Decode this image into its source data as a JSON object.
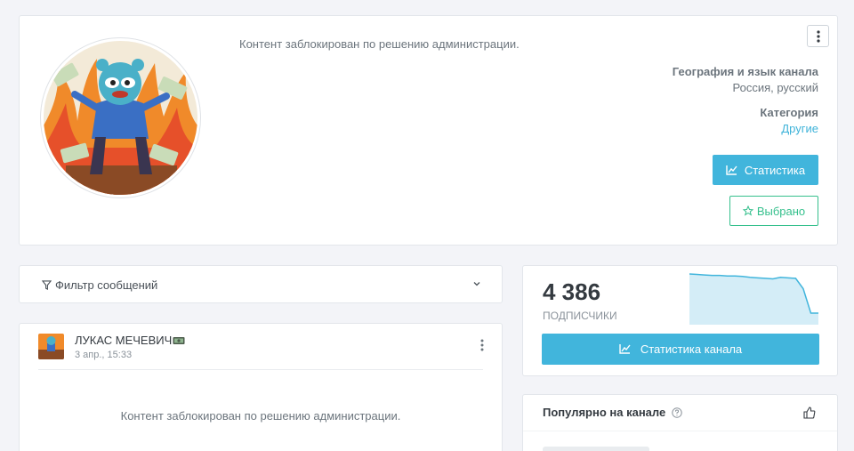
{
  "channel": {
    "blocked_text": "Контент заблокирован по решению администрации.",
    "geo_title": "География и язык канала",
    "geo_value": "Россия, русский",
    "category_title": "Категория",
    "category_value": "Другие",
    "stats_button": "Статистика",
    "fav_button": "Выбрано",
    "menu_icon": "kebab-vertical-icon",
    "avatar_icon": "channel-avatar-frog"
  },
  "filter": {
    "label": "Фильтр сообщений",
    "icon": "filter-icon"
  },
  "post": {
    "author": "ЛУКАС МЕЧЕВИЧ",
    "badge_icon": "money-emoji-icon",
    "date": "3 апр., 15:33",
    "blocked_text": "Контент заблокирован по решению администрации."
  },
  "subscribers": {
    "count": "4 386",
    "label": "подписчики",
    "button": "Статистика канала",
    "chart_data": {
      "type": "area",
      "values": [
        100,
        99,
        98,
        97,
        97,
        96,
        96,
        95,
        93,
        92,
        91,
        90,
        93,
        92,
        91,
        70,
        20,
        20
      ]
    }
  },
  "popular": {
    "title": "Популярно на канале",
    "help_icon": "question-circle-icon",
    "like_icon": "thumbs-up-icon"
  },
  "colors": {
    "accent": "#41b5dc",
    "success": "#36c08d",
    "link": "#3fb3d9"
  }
}
